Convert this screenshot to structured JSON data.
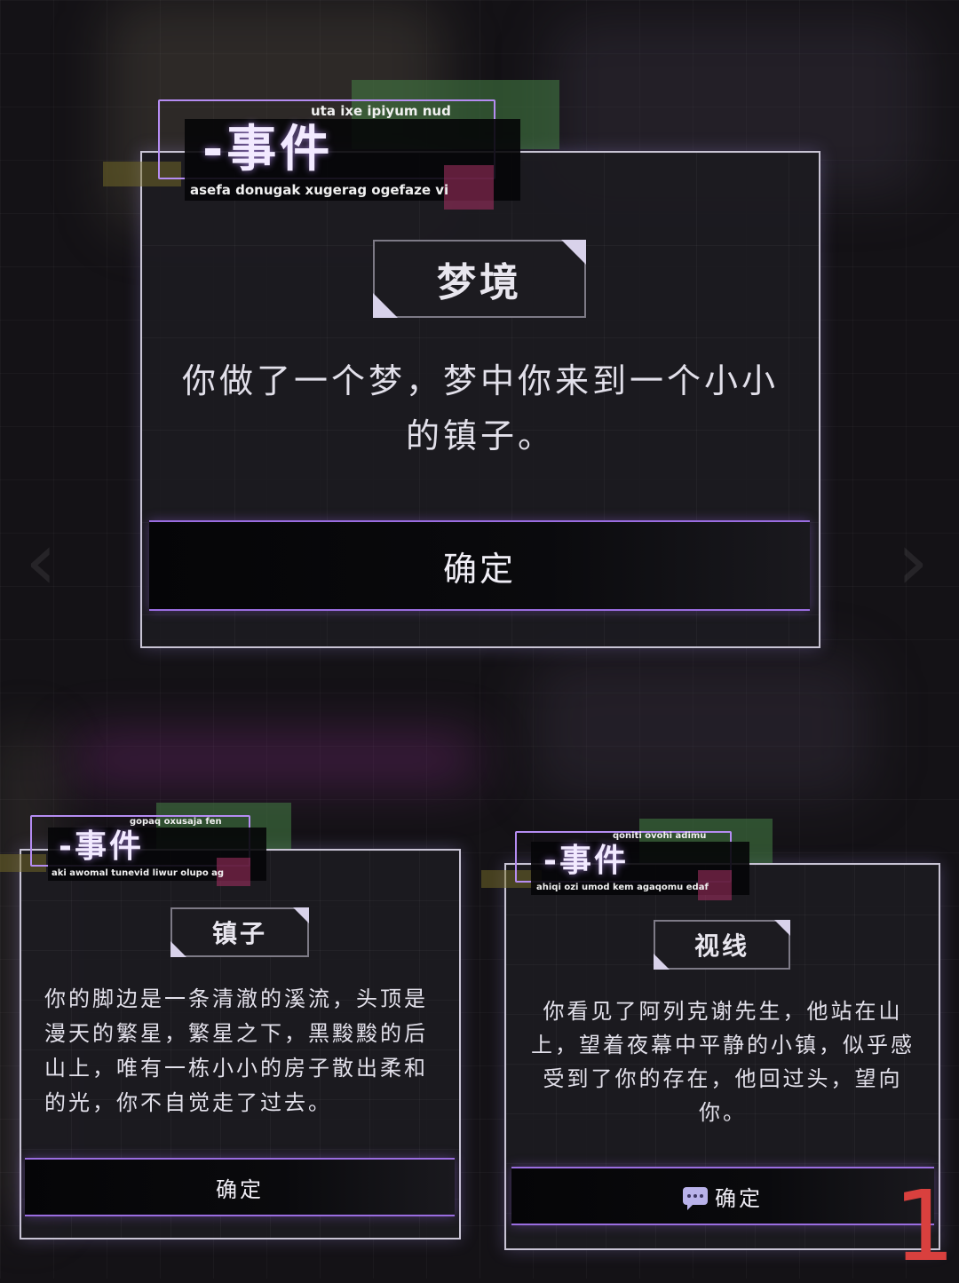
{
  "dialogs": [
    {
      "header": {
        "title": "-事件",
        "top_caption": "uta ixe ipiyum nud",
        "sub_caption": "asefa donugak xugerag ogefaze vi"
      },
      "tag": "梦境",
      "body": "你做了一个梦，梦中你来到一个小小的镇子。",
      "confirm_label": "确定"
    },
    {
      "header": {
        "title": "-事件",
        "top_caption": "gopaq oxusaja fen",
        "sub_caption": "aki awomal tunevid liwur olupo ag"
      },
      "tag": "镇子",
      "body": "你的脚边是一条清澈的溪流，头顶是漫天的繁星，繁星之下，黑黢黢的后山上，唯有一栋小小的房子散出柔和的光，你不自觉走了过去。",
      "confirm_label": "确定"
    },
    {
      "header": {
        "title": "-事件",
        "top_caption": "qoniti ovohi adimu",
        "sub_caption": "ahiqi ozi umod kem agaqomu edaf"
      },
      "tag": "视线",
      "body": "你看见了阿列克谢先生，他站在山上，望着夜幕中平静的小镇，似乎感受到了你的存在，他回过头，望向你。",
      "confirm_label": "确定",
      "confirm_icon": "chat-bubble-icon"
    }
  ],
  "page_number": "1",
  "colors": {
    "accent_purple": "#9a6de0",
    "page_number": "#d9403e",
    "card_border": "#c8c4d4"
  }
}
